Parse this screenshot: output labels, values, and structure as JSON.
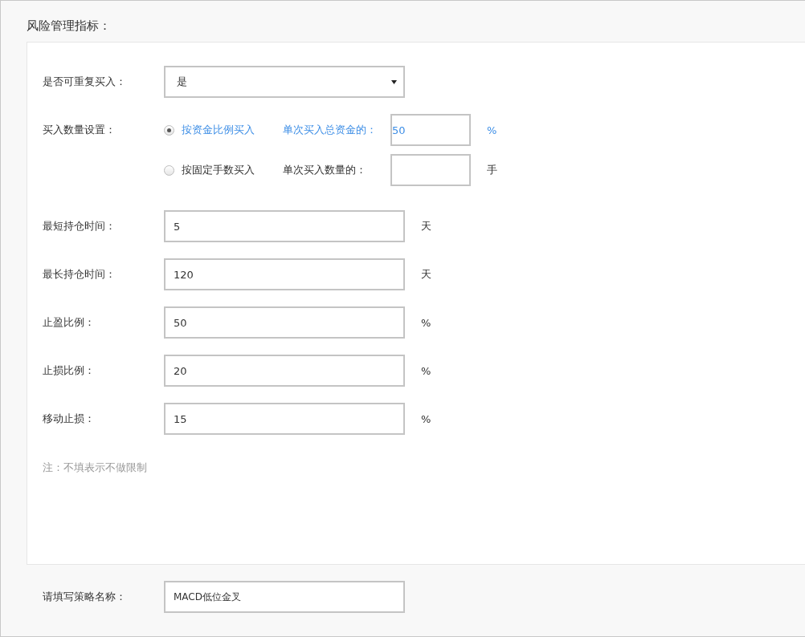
{
  "section_title": "风险管理指标：",
  "repeat_buy": {
    "label": "是否可重复买入：",
    "value": "是"
  },
  "quantity": {
    "label": "买入数量设置：",
    "options": [
      {
        "label": "按资金比例买入",
        "selected": true,
        "field_label": "单次买入总资金的：",
        "value": "50",
        "unit": "%"
      },
      {
        "label": "按固定手数买入",
        "selected": false,
        "field_label": "单次买入数量的：",
        "unit": "手"
      }
    ]
  },
  "fields": [
    {
      "label": "最短持仓时间：",
      "value": "5",
      "unit": "天"
    },
    {
      "label": "最长持仓时间：",
      "value": "120",
      "unit": "天"
    },
    {
      "label": "止盈比例：",
      "value": "50",
      "unit": "%"
    },
    {
      "label": "止损比例：",
      "value": "20",
      "unit": "%"
    },
    {
      "label": "移动止损：",
      "value": "15",
      "unit": "%"
    }
  ],
  "note": "注：不填表示不做限制",
  "strategy_name": {
    "label": "请填写策略名称：",
    "value": "MACD低位金叉"
  }
}
